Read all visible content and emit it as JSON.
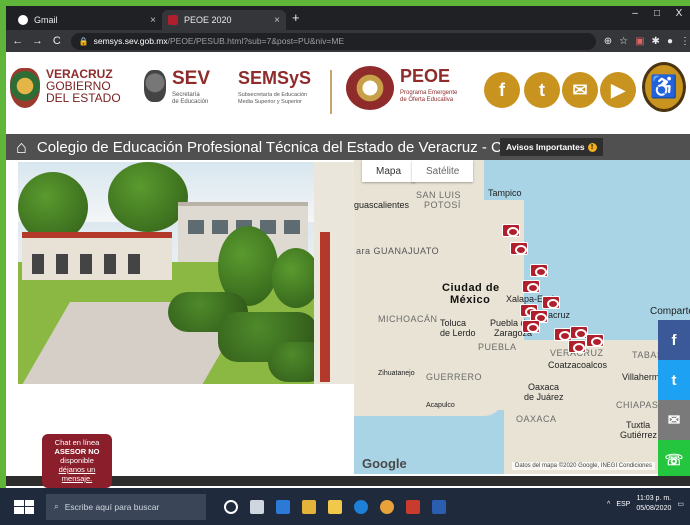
{
  "browser": {
    "tabs": [
      {
        "label": "Gmail",
        "close": "×"
      },
      {
        "label": "PEOE 2020",
        "close": "×"
      }
    ],
    "new_tab": "+",
    "window_controls": [
      "–",
      "□",
      "X"
    ],
    "url_host": "semsys.sev.gob.mx",
    "url_path": "/PEOE/PESUB.html?sub=7&post=PU&niv=ME"
  },
  "header": {
    "veracruz_line1": "VERACRUZ",
    "veracruz_line2": "GOBIERNO",
    "veracruz_line3": "DEL ESTADO",
    "sev": "SEV",
    "sev_sub1": "Secretaría",
    "sev_sub2": "de Educación",
    "semsys": "SEMSyS",
    "semsys_sub1": "Subsecretaría de Educación",
    "semsys_sub2": "Media Superior y Superior",
    "peoe": "PEOE",
    "peoe_sub1": "Programa Emergente",
    "peoe_sub2": "de Oferta Educativa",
    "social_icons": [
      "facebook-icon",
      "twitter-icon",
      "mail-icon",
      "youtube-icon",
      "accessibility-icon"
    ]
  },
  "title": {
    "text": "Colegio de Educación Profesional Técnica del Estado de Veracruz - CON",
    "avisos": "Avisos Importantes"
  },
  "map": {
    "tab_map": "Mapa",
    "tab_satellite": "Satélite",
    "labels": {
      "san_luis": "SAN LUIS",
      "potosi": "POTOSÍ",
      "tampico": "Tampico",
      "guascalientes": "guascalientes",
      "guanajuato": "ara GUANAJUATO",
      "ciudad": "Ciudad de",
      "mexico": "México",
      "michoacan": "MICHOACÁN",
      "toluca": "Toluca",
      "de_lerdo": "de Lerdo",
      "xalapa": "Xalapa-Enríq",
      "veracruz_city": "acruz",
      "puebla_city": "Puebla de",
      "zaragoza": "Zaragoza",
      "puebla": "PUEBLA",
      "veracruz_state": "VERACRUZ",
      "coatza": "Coatzacoalcos",
      "zihuatanejo": "Zihuatanejo",
      "guerrero": "GUERRERO",
      "oaxaca_city": "Oaxaca",
      "de_juarez": "de Juárez",
      "oaxaca": "OAXACA",
      "acapulco": "Acapulco",
      "chiapas": "CHIAPAS",
      "tuxtla": "Tuxtla",
      "gutierrez": "Gutiérrez",
      "tabasco": "TABAS",
      "villahermosa": "Villahermosa",
      "comparte": "Comparte"
    },
    "google": "Google",
    "footer": "Datos del mapa ©2020 Google, INEGI   Condiciones"
  },
  "share": [
    "f",
    "t",
    "✉",
    "☏"
  ],
  "chat": {
    "line1": "Chat en línea",
    "line2": "ASESOR NO",
    "line3": "disponible",
    "line4": "déjanos un",
    "line5": "mensaje."
  },
  "taskbar": {
    "search_placeholder": "Escribe aquí para buscar",
    "lang": "ESP",
    "time": "11:03 p. m.",
    "date": "05/08/2020"
  }
}
